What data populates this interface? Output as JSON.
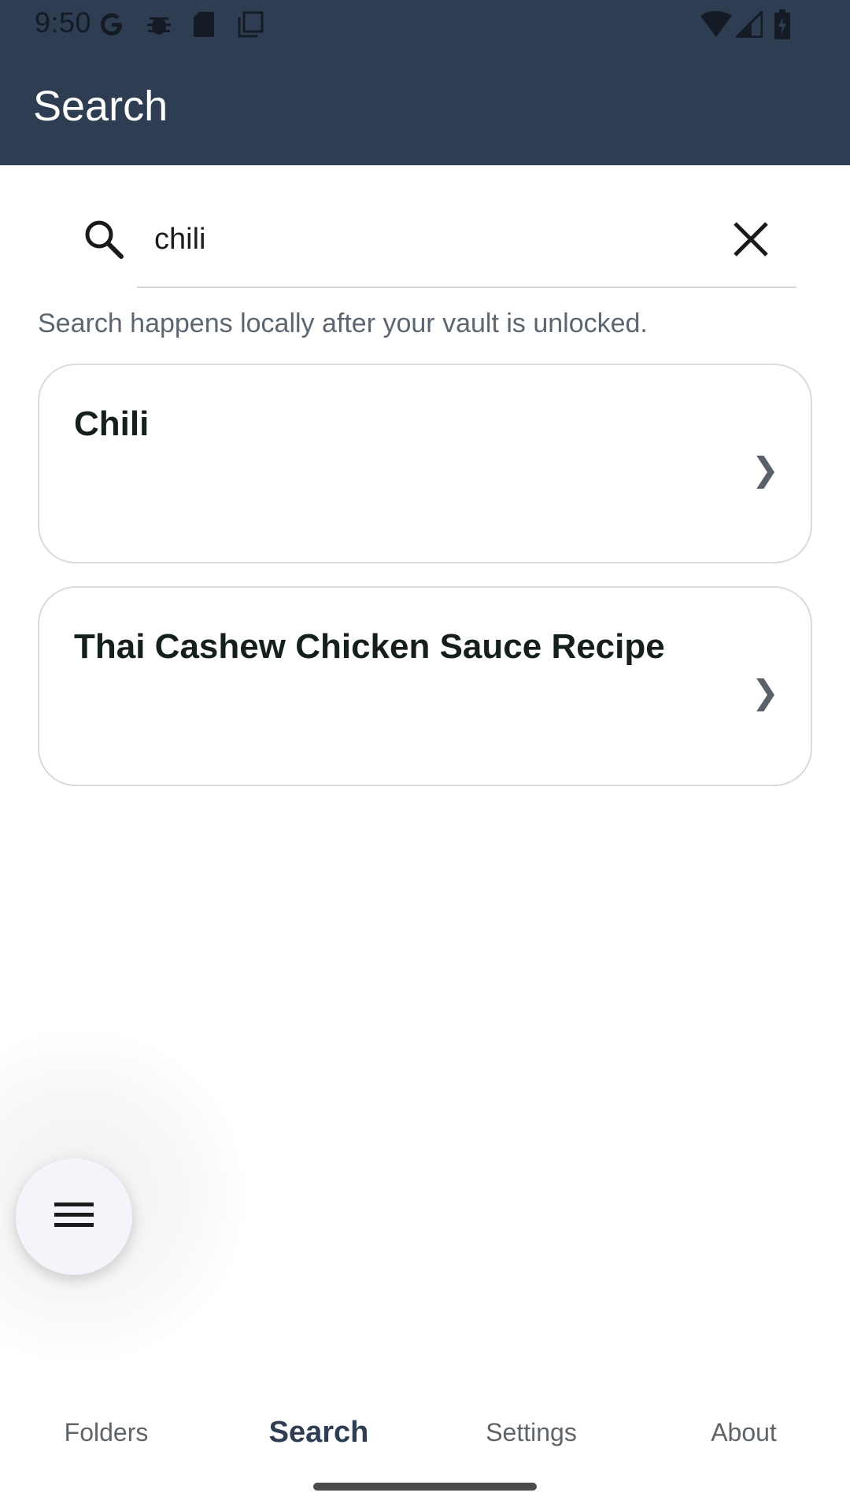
{
  "status_bar": {
    "time": "9:50"
  },
  "app_bar": {
    "title": "Search"
  },
  "search": {
    "value": "chili",
    "hint": "Search happens locally after your vault is unlocked."
  },
  "results": [
    {
      "title": "Chili",
      "chevron": "❯"
    },
    {
      "title": "Thai Cashew Chicken Sauce Recipe",
      "chevron": "❯"
    }
  ],
  "bottom_nav": {
    "items": [
      {
        "label": "Folders",
        "active": false
      },
      {
        "label": "Search",
        "active": true
      },
      {
        "label": "Settings",
        "active": false
      },
      {
        "label": "About",
        "active": false
      }
    ]
  },
  "colors": {
    "header": "#2e3d51",
    "accent": "#2e3d51",
    "fab_background": "#f5f4fb"
  },
  "icons": {
    "search": "search-icon",
    "clear": "close-icon",
    "fab": "menu-icon"
  }
}
